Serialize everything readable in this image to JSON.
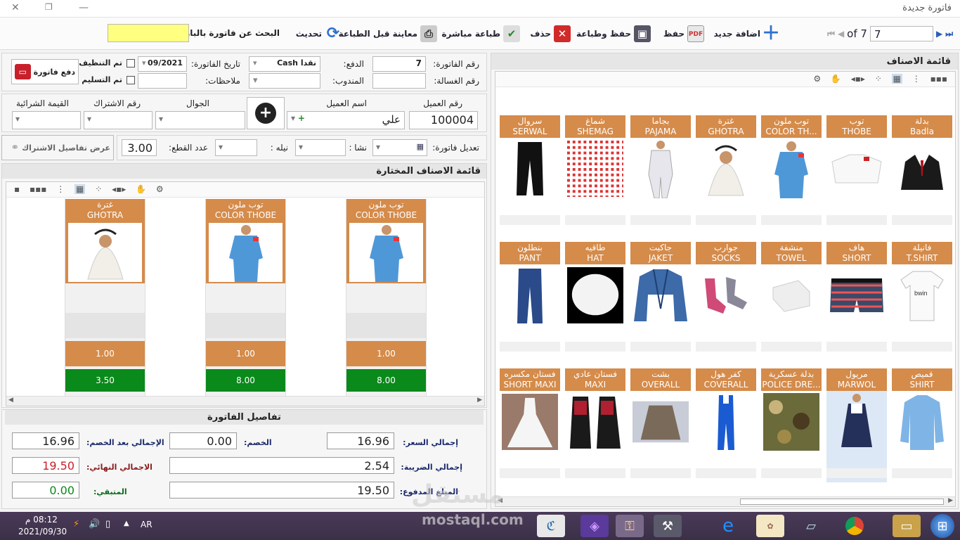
{
  "window": {
    "title": "فاتورة جديدة"
  },
  "toolbar": {
    "add_new": "اضافة جديد",
    "save": "حفظ",
    "save_print": "حفظ وطباعة",
    "delete": "حذف",
    "direct_print": "طباعة مباشرة",
    "preview": "معاينة قبل الطباعة",
    "refresh": "تحديث",
    "barcode_search_label": "البحث عن فاتورة بالباركود:",
    "barcode_value": "",
    "record_current": "7",
    "record_of": "of 7"
  },
  "invoice": {
    "invoice_no_label": "رقم الفاتورة:",
    "invoice_no": "7",
    "payment_label": "الدفع:",
    "payment_value": "Cash نقدا",
    "date_label": "تاريخ الفاتورة:",
    "date_value": "09/2021",
    "cleaned_label": "تم التنظيف",
    "delivered_label": "تم التسليم",
    "pay_button": "دفع فاتورة",
    "washer_label": "رقم الغسالة:",
    "washer_value": "",
    "rep_label": "المندوب:",
    "rep_value": "",
    "notes_label": "ملاحظات:",
    "notes_value": ""
  },
  "customer": {
    "no_label": "رقم العميل",
    "no_value": "100004",
    "name_label": "اسم العميل",
    "name_value": "علي",
    "mobile_label": "الجوال",
    "sub_no_label": "رقم الاشتراك",
    "sub_value_label": "القيمة الشرائية"
  },
  "edit": {
    "edit_label": "تعديل فاتورة:",
    "starch_label": "نشا :",
    "blue_label": "نيله :",
    "pieces_label": "عدد القطع:",
    "pieces_value": "3.00",
    "sub_details_button": "عرض تفاصيل الاشتراك"
  },
  "selected": {
    "title": "قائمة الاصناف المختارة",
    "items": [
      {
        "ar": "توب ملون",
        "en": "COLOR THOBE",
        "qty": "1.00",
        "price": "8.00",
        "img": "thobe-color"
      },
      {
        "ar": "توب ملون",
        "en": "COLOR THOBE",
        "qty": "1.00",
        "price": "8.00",
        "img": "thobe-color"
      },
      {
        "ar": "غترة",
        "en": "GHOTRA",
        "qty": "1.00",
        "price": "3.50",
        "img": "ghotra"
      }
    ]
  },
  "totals": {
    "title": "تفاصيل الفاتورة",
    "price_total_label": "إجمالي السعر:",
    "price_total": "16.96",
    "discount_label": "الخصم:",
    "discount": "0.00",
    "after_discount_label": "الإجمالي بعد الخصم:",
    "after_discount": "16.96",
    "tax_label": "إجمالي الضريبة:",
    "tax": "2.54",
    "final_label": "الاجمالي النهائي:",
    "final": "19.50",
    "paid_label": "المبلغ المدفوع:",
    "paid": "19.50",
    "remaining_label": "المتبقي:",
    "remaining": "0.00"
  },
  "catalog": {
    "title": "قائمة الاصناف",
    "items": [
      {
        "ar": "بدلة",
        "en": "Badla",
        "img": "suit"
      },
      {
        "ar": "توب",
        "en": "THOBE",
        "img": "thobe-white"
      },
      {
        "ar": "توب ملون",
        "en": "COLOR TH...",
        "img": "thobe-color"
      },
      {
        "ar": "غترة",
        "en": "GHOTRA",
        "img": "ghotra"
      },
      {
        "ar": "بجاما",
        "en": "PAJAMA",
        "img": "pajama"
      },
      {
        "ar": "شماغ",
        "en": "SHEMAG",
        "img": "shemag"
      },
      {
        "ar": "سروال",
        "en": "SERWAL",
        "img": "serwal"
      },
      {
        "ar": "فانيلة",
        "en": "T.SHIRT",
        "img": "tshirt"
      },
      {
        "ar": "هاف",
        "en": "SHORT",
        "img": "short"
      },
      {
        "ar": "منشفة",
        "en": "TOWEL",
        "img": "towel"
      },
      {
        "ar": "جوارب",
        "en": "SOCKS",
        "img": "socks"
      },
      {
        "ar": "جاكيت",
        "en": "JAKET",
        "img": "jacket"
      },
      {
        "ar": "طاقيه",
        "en": "HAT",
        "img": "hat"
      },
      {
        "ar": "بنطلون",
        "en": "PANT",
        "img": "pant"
      },
      {
        "ar": "قميص",
        "en": "SHIRT",
        "img": "shirt"
      },
      {
        "ar": "مريول",
        "en": "MARWOL",
        "img": "marwol"
      },
      {
        "ar": "بدلة عسكرية",
        "en": "POLICE DRE...",
        "img": "police"
      },
      {
        "ar": "كفر هول",
        "en": "COVERALL",
        "img": "coverall"
      },
      {
        "ar": "بشت",
        "en": "OVERALL",
        "img": "bisht"
      },
      {
        "ar": "فستان عادي",
        "en": "MAXI",
        "img": "maxi"
      },
      {
        "ar": "فستان مكسره",
        "en": "SHORT MAXI",
        "img": "dress"
      }
    ]
  },
  "taskbar": {
    "time": "08:12 م",
    "date": "2021/09/30",
    "lang": "AR"
  },
  "watermark": {
    "brand": "مستقل",
    "site": "mostaql.com"
  },
  "colors": {
    "orange": "#d58b4a",
    "green": "#0a8a1a",
    "yellow": "#ffff80"
  }
}
